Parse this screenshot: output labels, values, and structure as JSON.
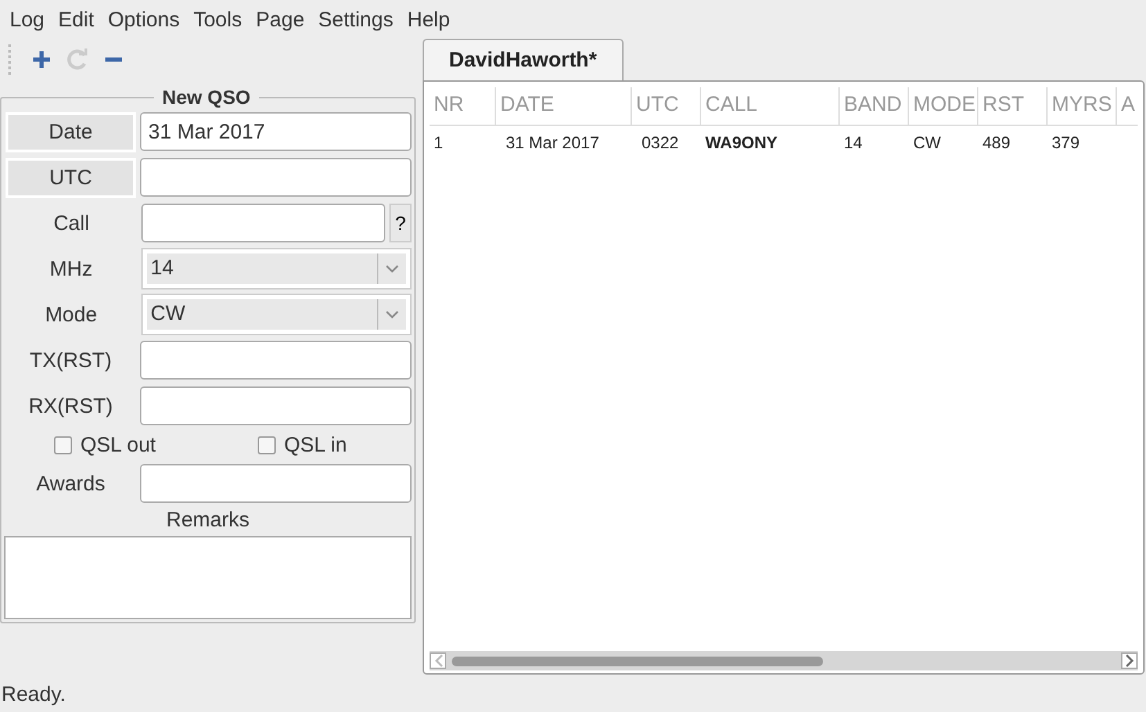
{
  "menu": [
    "Log",
    "Edit",
    "Options",
    "Tools",
    "Page",
    "Settings",
    "Help"
  ],
  "toolbar": [
    {
      "kind": "add",
      "disabled": false
    },
    {
      "kind": "refresh",
      "disabled": true
    },
    {
      "kind": "remove",
      "disabled": false
    }
  ],
  "form": {
    "title": "New QSO",
    "rows": [
      {
        "kind": "button-input",
        "label": "Date",
        "value": "31 Mar 2017"
      },
      {
        "kind": "button-input",
        "label": "UTC"
      },
      {
        "kind": "input-help",
        "label": "Call",
        "help": "?"
      },
      {
        "kind": "combo",
        "label": "MHz",
        "value": "14"
      },
      {
        "kind": "combo",
        "label": "Mode",
        "value": "CW"
      },
      {
        "kind": "input",
        "label": "TX(RST)"
      },
      {
        "kind": "input",
        "label": "RX(RST)"
      }
    ],
    "checks": [
      {
        "label": "QSL out",
        "checked": false
      },
      {
        "label": "QSL in",
        "checked": false
      }
    ],
    "awards": {
      "label": "Awards"
    },
    "remarks": {
      "label": "Remarks"
    }
  },
  "tabs": [
    {
      "label": "DavidHaworth*",
      "selected": true
    }
  ],
  "table": {
    "columns": [
      "NR",
      "DATE",
      "UTC",
      "CALL",
      "BAND",
      "MODE",
      "RST",
      "MYRS",
      "A"
    ],
    "rows": [
      [
        "1",
        "31 Mar 2017",
        "0322",
        "WA9ONY",
        "14",
        "CW",
        "489",
        "379"
      ]
    ]
  },
  "status_bar": "Ready."
}
